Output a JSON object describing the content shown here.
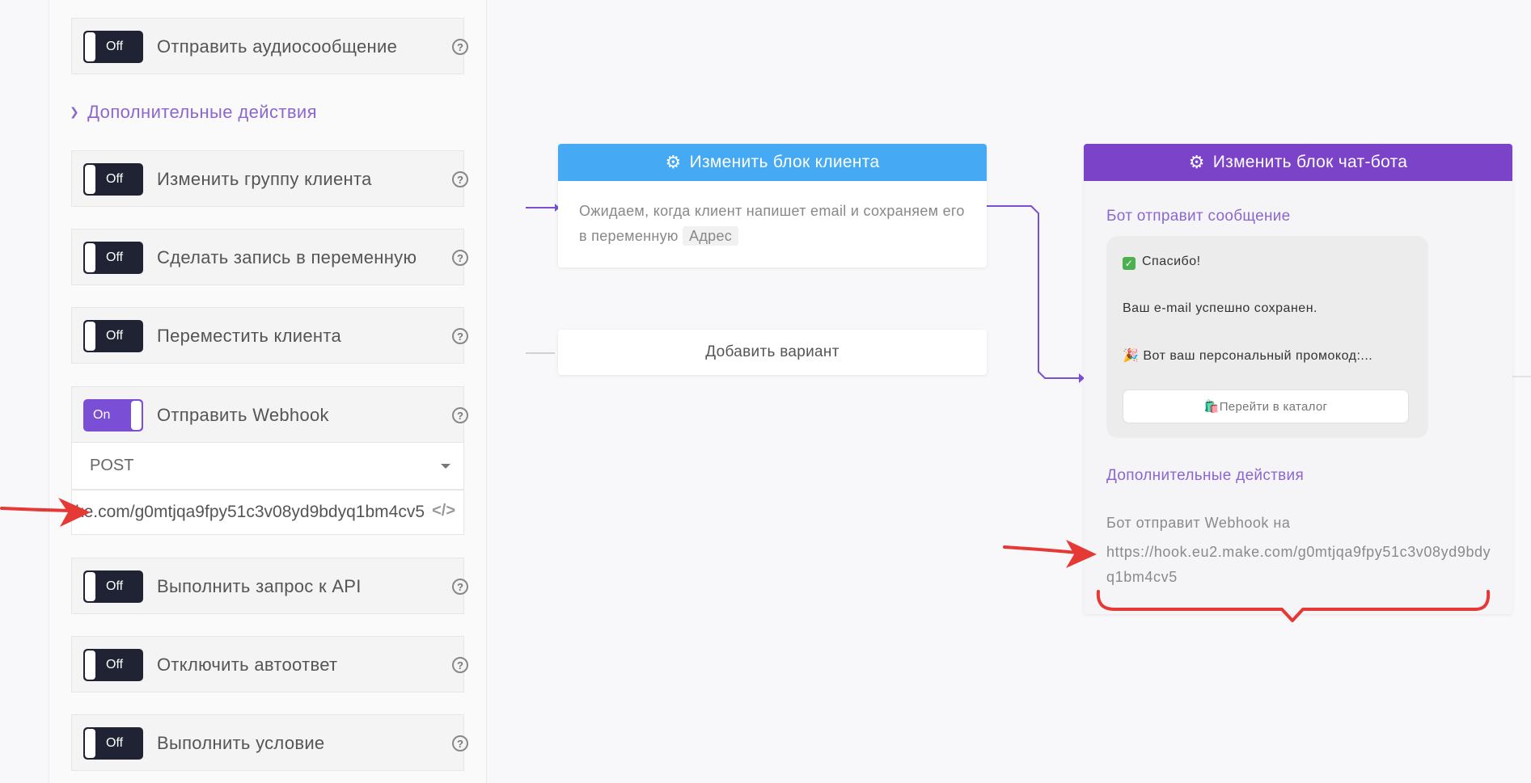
{
  "panel": {
    "audio": {
      "toggle": "Off",
      "label": "Отправить аудиосообщение"
    },
    "section_title": "Дополнительные действия",
    "actions": [
      {
        "toggle": "Off",
        "label": "Изменить группу клиента"
      },
      {
        "toggle": "Off",
        "label": "Сделать запись в переменную"
      },
      {
        "toggle": "Off",
        "label": "Переместить клиента"
      },
      {
        "toggle": "On",
        "label": "Отправить Webhook"
      },
      {
        "toggle": "Off",
        "label": "Выполнить запрос к API"
      },
      {
        "toggle": "Off",
        "label": "Отключить автоответ"
      },
      {
        "toggle": "Off",
        "label": "Выполнить условие"
      }
    ],
    "webhook": {
      "method": "POST",
      "url": "https://hook.eu2.make.com/g0mtjqa9fpy51c3v08yd9bdyq1bm4cv5",
      "code_icon": "</>"
    },
    "help_symbol": "?"
  },
  "canvas": {
    "client_node": {
      "title": "Изменить блок клиента",
      "text": "Ожидаем, когда клиент напишет email и сохраняем его в переменную",
      "variable": "Адрес"
    },
    "add_variant": "Добавить вариант",
    "bot_node": {
      "title": "Изменить блок чат-бота",
      "message_heading": "Бот отправит сообщение",
      "message_lines": [
        "Спасибо!",
        "Ваш e-mail успешно сохранен.",
        "🎉 Вот ваш персональный промокод:..."
      ],
      "message_button": "🛍️Перейти в каталог",
      "actions_heading": "Дополнительные действия",
      "webhook_text": "Бот отправит Webhook на",
      "webhook_url": "https://hook.eu2.make.com/g0mtjqa9fpy51c3v08yd9bdyq1bm4cv5"
    }
  },
  "colors": {
    "accent": "#7b43c8",
    "client_header": "#45a9f3",
    "annotation": "#e53935",
    "toggle_off": "#1f2333"
  }
}
